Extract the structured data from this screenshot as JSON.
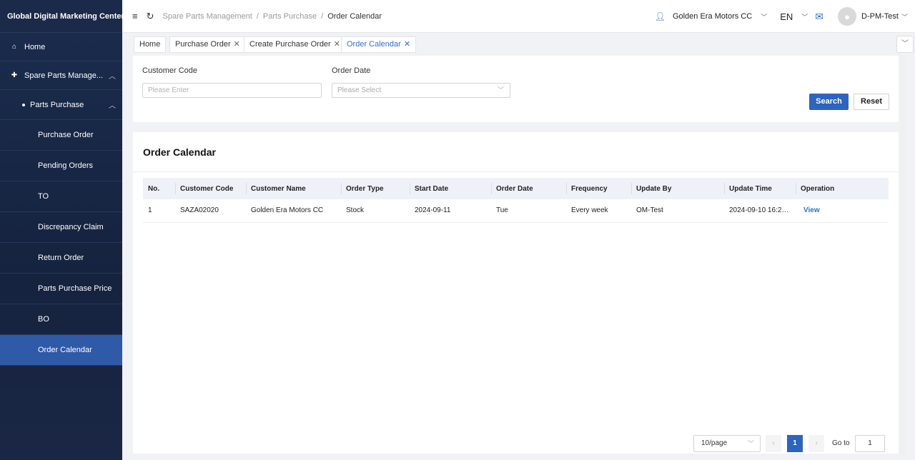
{
  "sidebar": {
    "title": "Global Digital Marketing Center",
    "home": "Home",
    "spare_parts": "Spare Parts Manage...",
    "parts_purchase": "Parts Purchase",
    "items": [
      "Purchase Order",
      "Pending Orders",
      "TO",
      "Discrepancy Claim",
      "Return Order",
      "Parts Purchase Price",
      "BO",
      "Order Calendar"
    ]
  },
  "header": {
    "breadcrumb": [
      "Spare Parts Management",
      "Parts Purchase",
      "Order Calendar"
    ],
    "dealer": "Golden Era Motors CC",
    "language": "EN",
    "username": "D-PM-Test"
  },
  "tabs": [
    "Home",
    "Purchase Order",
    "Create Purchase Order",
    "Order Calendar"
  ],
  "filter": {
    "customer_code_label": "Customer Code",
    "customer_code_placeholder": "Please Enter",
    "order_date_label": "Order Date",
    "order_date_placeholder": "Please Select",
    "search_label": "Search",
    "reset_label": "Reset"
  },
  "main": {
    "title": "Order Calendar",
    "columns": [
      "No.",
      "Customer Code",
      "Customer Name",
      "Order Type",
      "Start Date",
      "Order Date",
      "Frequency",
      "Update By",
      "Update Time",
      "Operation"
    ],
    "rows": [
      [
        "1",
        "SAZA02020",
        "Golden Era Motors CC",
        "Stock",
        "2024-09-11",
        "Tue",
        "Every week",
        "OM-Test",
        "2024-09-10 16:2…",
        "View"
      ]
    ]
  },
  "pagination": {
    "page_size": "10/page",
    "current_page": "1",
    "goto_label": "Go to",
    "goto_value": "1"
  },
  "colors": {
    "accent": "#2d63c1",
    "sidebar_bg": "#1b2c4d",
    "sidebar_active": "#2e5aa7"
  }
}
